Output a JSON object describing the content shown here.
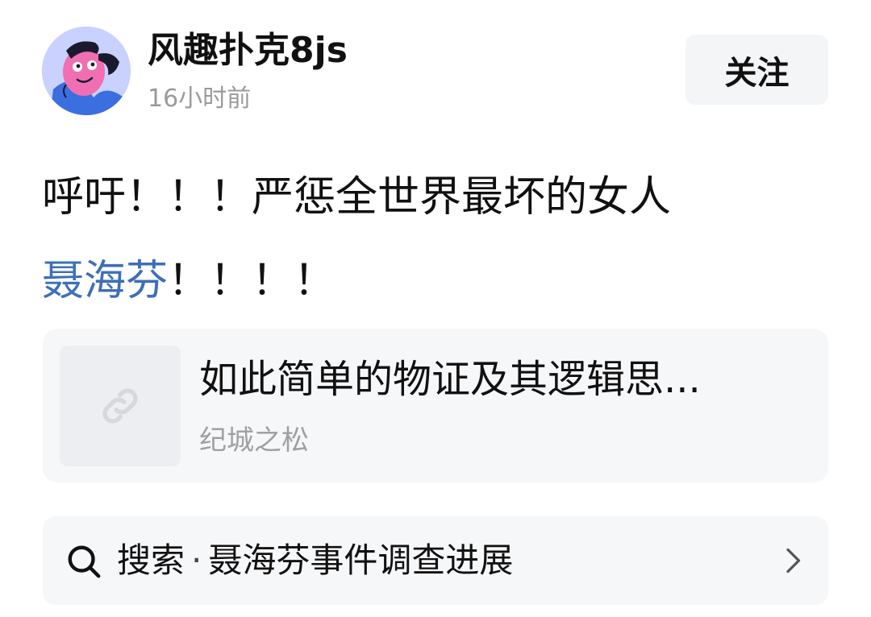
{
  "header": {
    "username": "风趣扑克8js",
    "timestamp": "16小时前",
    "follow_label": "关注",
    "avatar_icon": "cartoon-avatar"
  },
  "post": {
    "line1": "呼吁！！！严惩全世界最坏的女人",
    "hashtag": "聂海芬",
    "line2_suffix": "！！！！"
  },
  "link_card": {
    "thumb_icon": "link-icon",
    "title": "如此简单的物证及其逻辑思...",
    "source": "纪城之松"
  },
  "search": {
    "prefix": "搜索",
    "separator": "·",
    "query": "聂海芬事件调查进展",
    "icon": "search-icon",
    "trailing_icon": "chevron-right-icon"
  },
  "colors": {
    "hashtag": "#3d6fb8",
    "secondary_text": "#9a9a9a",
    "card_bg": "#f6f7f9"
  }
}
